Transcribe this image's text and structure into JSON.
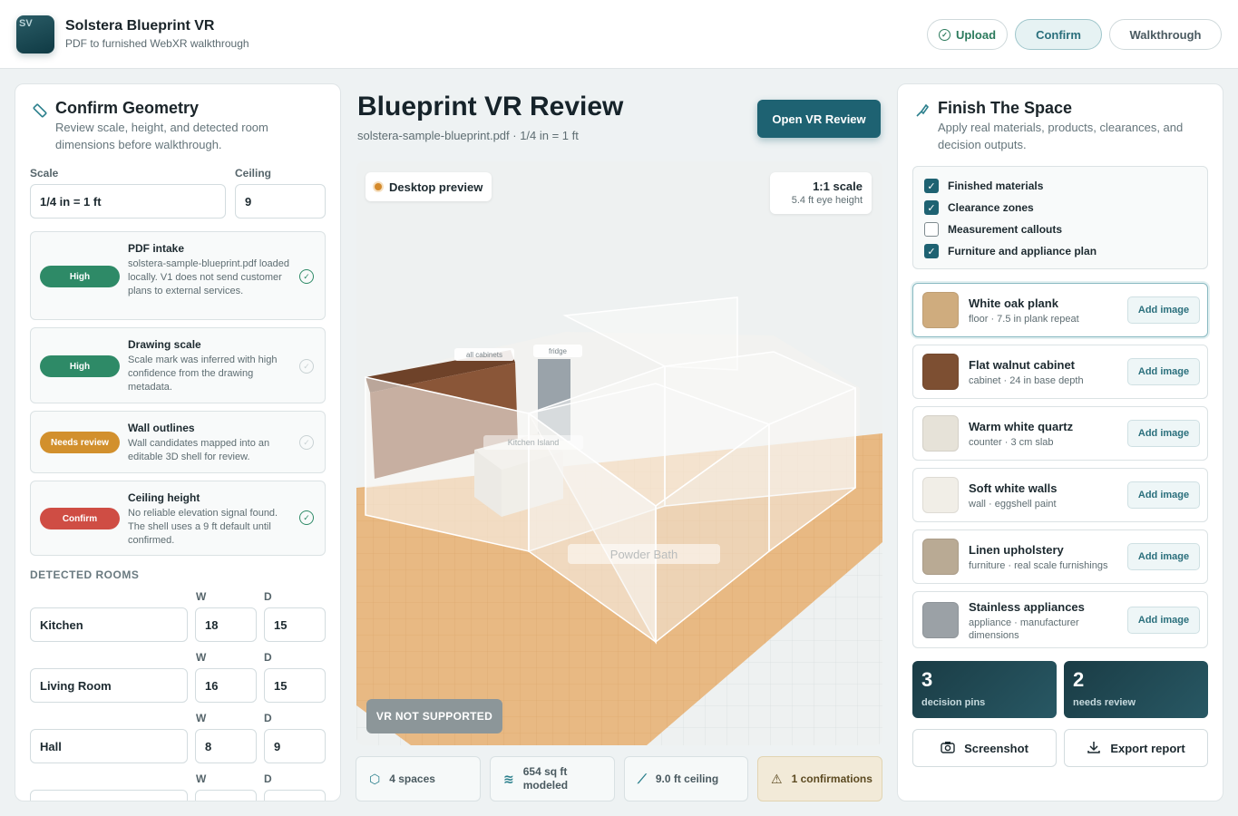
{
  "app": {
    "logo": "SV",
    "title": "Solstera Blueprint VR",
    "subtitle": "PDF to furnished WebXR walkthrough"
  },
  "nav": {
    "upload": "Upload",
    "confirm": "Confirm",
    "walkthrough": "Walkthrough"
  },
  "geometry": {
    "title": "Confirm Geometry",
    "description": "Review scale, height, and detected room dimensions before walkthrough.",
    "scale_label": "Scale",
    "scale_value": "1/4 in = 1 ft",
    "ceiling_label": "Ceiling",
    "ceiling_value": "9",
    "checks": [
      {
        "badge": "High",
        "title": "PDF intake",
        "text": "solstera-sample-blueprint.pdf loaded locally. V1 does not send customer plans to external services.",
        "confirmed": true
      },
      {
        "badge": "High",
        "title": "Drawing scale",
        "text": "Scale mark was inferred with high confidence from the drawing metadata.",
        "confirmed": false
      },
      {
        "badge": "Needs review",
        "title": "Wall outlines",
        "text": "Wall candidates mapped into an editable 3D shell for review.",
        "confirmed": false
      },
      {
        "badge": "Confirm",
        "title": "Ceiling height",
        "text": "No reliable elevation signal found. The shell uses a 9 ft default until confirmed.",
        "confirmed": true
      }
    ],
    "rooms_label": "DETECTED ROOMS",
    "w_label": "W",
    "d_label": "D",
    "rooms": [
      {
        "name": "Kitchen",
        "w": "18",
        "d": "15"
      },
      {
        "name": "Living Room",
        "w": "16",
        "d": "15"
      },
      {
        "name": "Hall",
        "w": "8",
        "d": "9"
      },
      {
        "name": "",
        "w": "",
        "d": ""
      }
    ]
  },
  "review": {
    "title": "Blueprint VR Review",
    "subtitle": "solstera-sample-blueprint.pdf · 1/4 in = 1 ft",
    "open_vr": "Open VR Review",
    "preview_badge": "Desktop preview",
    "scale_line1": "1:1 scale",
    "scale_line2": "5.4 ft eye height",
    "vr_status": "VR NOT SUPPORTED",
    "scene_labels": [
      "all cabinets",
      "fridge",
      "Kitchen Island",
      "Powder Bath"
    ],
    "stats": [
      {
        "icon": "cube-icon",
        "text": "4 spaces"
      },
      {
        "icon": "layers-icon",
        "text": "654 sq ft modeled"
      },
      {
        "icon": "ruler-icon",
        "text": "9.0 ft ceiling"
      },
      {
        "icon": "warning-icon",
        "text": "1 confirmations"
      }
    ]
  },
  "finish": {
    "title": "Finish The Space",
    "description": "Apply real materials, products, clearances, and decision outputs.",
    "toggles": [
      {
        "label": "Finished materials",
        "checked": true
      },
      {
        "label": "Clearance zones",
        "checked": true
      },
      {
        "label": "Measurement callouts",
        "checked": false
      },
      {
        "label": "Furniture and appliance plan",
        "checked": true
      }
    ],
    "add_image": "Add image",
    "materials": [
      {
        "name": "White oak plank",
        "meta": "floor · 7.5 in plank repeat",
        "color": "#cfac7e"
      },
      {
        "name": "Flat walnut cabinet",
        "meta": "cabinet · 24 in base depth",
        "color": "#7d4f32"
      },
      {
        "name": "Warm white quartz",
        "meta": "counter · 3 cm slab",
        "color": "#e6e2d8"
      },
      {
        "name": "Soft white walls",
        "meta": "wall · eggshell paint",
        "color": "#f1eee7"
      },
      {
        "name": "Linen upholstery",
        "meta": "furniture · real scale furnishings",
        "color": "#b9aa94"
      },
      {
        "name": "Stainless appliances",
        "meta": "appliance · manufacturer dimensions",
        "color": "#9ba1a6"
      }
    ],
    "pins": [
      {
        "number": "3",
        "label": "decision pins"
      },
      {
        "number": "2",
        "label": "needs review"
      }
    ],
    "screenshot": "Screenshot",
    "export": "Export report"
  }
}
